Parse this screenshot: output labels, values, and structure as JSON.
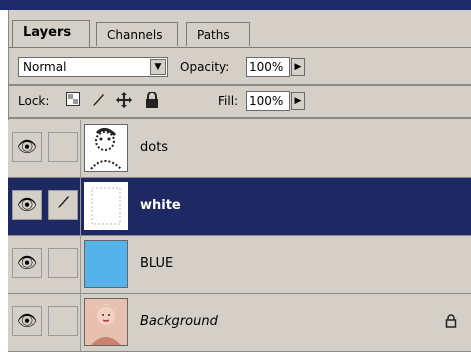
{
  "tabs": [
    {
      "label": "Layers",
      "active": true
    },
    {
      "label": "Channels",
      "active": false
    },
    {
      "label": "Paths",
      "active": false
    }
  ],
  "controls": {
    "blend_mode": "Normal",
    "opacity_label": "Opacity:",
    "opacity_value": "100%",
    "lock_label": "Lock:",
    "fill_label": "Fill:",
    "fill_value": "100%"
  },
  "icons": {
    "dropdown": "chevron-down-icon",
    "spinner": "chevron-right-icon",
    "lock_transparent": "checker-icon",
    "lock_paint": "brush-icon",
    "lock_move": "move-icon",
    "lock_all": "lock-icon",
    "visibility": "eye-icon"
  },
  "layers": [
    {
      "name": "dots",
      "selected": false,
      "thumb_color": "#ffffff"
    },
    {
      "name": "white",
      "selected": true,
      "thumb_color": "#ffffff"
    },
    {
      "name": "BLUE",
      "selected": false,
      "thumb_color": "#55b3ea"
    },
    {
      "name": "Background",
      "selected": false,
      "locked": true,
      "thumb_color": "#e8b9a8"
    }
  ],
  "colors": {
    "panel_bg": "#d4d0c8",
    "selected_row": "#1e2862",
    "title_bar": "#1f2a6b"
  }
}
